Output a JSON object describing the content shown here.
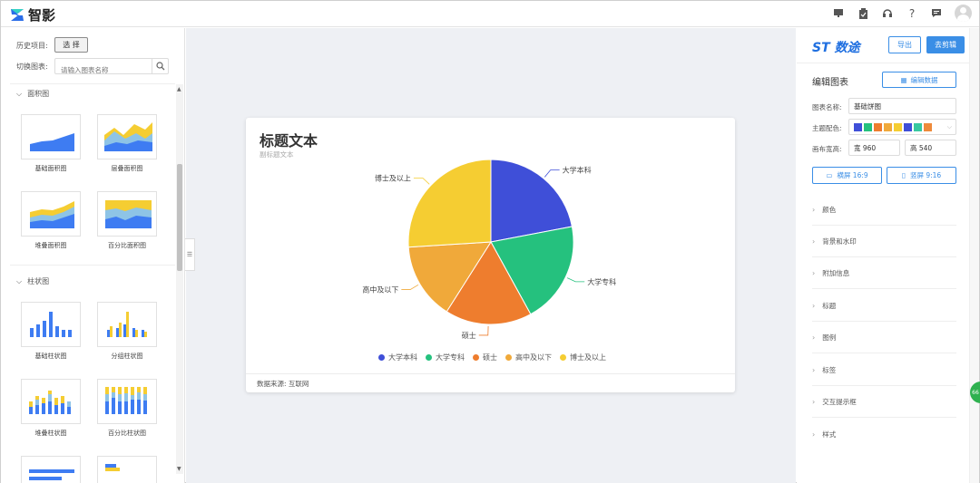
{
  "app": {
    "name": "智影"
  },
  "left": {
    "history_label": "历史项目:",
    "select_button": "选 择",
    "switch_label": "切换图表:",
    "search_placeholder": "请输入图表名称",
    "sections": [
      {
        "title": "面积图",
        "items": [
          "基础面积图",
          "层叠面积图",
          "堆叠面积图",
          "百分比面积图"
        ]
      },
      {
        "title": "柱状图",
        "items": [
          "基础柱状图",
          "分组柱状图",
          "堆叠柱状图",
          "百分比柱状图"
        ]
      }
    ]
  },
  "chart": {
    "title": "标题文本",
    "subtitle": "副标题文本",
    "source": "数据来源: 互联网",
    "colors": [
      "#3f4fd8",
      "#25c17e",
      "#ee7d2e",
      "#f0a93a",
      "#f5cd32"
    ]
  },
  "chart_data": {
    "type": "pie",
    "title": "标题文本",
    "subtitle": "副标题文本",
    "categories": [
      "大学本科",
      "大学专科",
      "硕士",
      "高中及以下",
      "博士及以上"
    ],
    "values": [
      22,
      20,
      17,
      15,
      26
    ],
    "legend_position": "bottom"
  },
  "right": {
    "brand": "数途",
    "export_button": "导出",
    "go_edit_button": "去剪辑",
    "edit_chart_title": "编辑图表",
    "edit_data_button": "编辑数据",
    "chart_name_label": "图表名称:",
    "chart_name_value": "基础饼图",
    "theme_label": "主题配色:",
    "theme_swatches": [
      "#3f4fd8",
      "#25c17e",
      "#ee7d2e",
      "#f0a93a",
      "#f5cd32",
      "#3f4fd8",
      "#37c8a0",
      "#ee8a3a"
    ],
    "canvas_label": "画布宽高:",
    "width_prefix": "宽",
    "width_value": "960",
    "height_prefix": "高",
    "height_value": "540",
    "landscape_button": "横屏 16:9",
    "portrait_button": "竖屏 9:16",
    "accordion": [
      "颜色",
      "背景和水印",
      "附加信息",
      "标题",
      "图例",
      "标签",
      "交互提示框",
      "样式"
    ]
  },
  "misc": {
    "floating_badge": "66"
  }
}
